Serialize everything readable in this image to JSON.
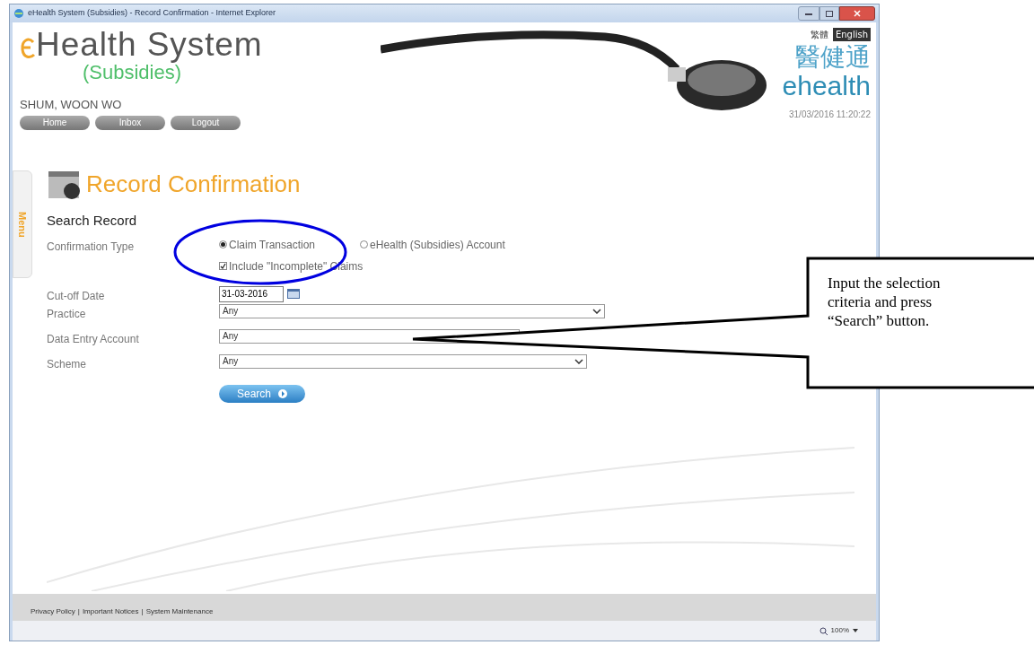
{
  "window": {
    "title": "eHealth System (Subsidies) - Record Confirmation - Internet Explorer"
  },
  "header": {
    "logo_title": "Health System",
    "logo_subtitle": "(Subsidies)",
    "user_name": "SHUM, WOON WO",
    "nav_buttons": [
      "Home",
      "Inbox",
      "Logout"
    ],
    "languages": [
      {
        "label": "繁體",
        "selected": false
      },
      {
        "label": "English",
        "selected": true
      }
    ],
    "brand_chinese": "醫健通",
    "brand_english": "ehealth",
    "datetime": "31/03/2016 11:20:22"
  },
  "side_menu": {
    "label": "Menu"
  },
  "page_title": "Record Confirmation",
  "form": {
    "section_title": "Search Record",
    "fields": [
      {
        "kind": "radio",
        "label": "Confirmation Type",
        "options": [
          {
            "label": "Claim Transaction",
            "selected": true
          },
          {
            "label": "eHealth (Subsidies) Account",
            "selected": false
          }
        ],
        "checkbox": {
          "label": "Include \"Incomplete\" Claims",
          "checked": true
        }
      },
      {
        "kind": "date",
        "label": "Cut-off Date",
        "value": "31-03-2016"
      },
      {
        "kind": "select",
        "label": "Practice",
        "value": "Any"
      },
      {
        "kind": "select",
        "label": "Data Entry Account",
        "value": "Any"
      },
      {
        "kind": "select",
        "label": "Scheme",
        "value": "Any"
      }
    ],
    "search_button": "Search"
  },
  "footer": {
    "links": [
      "Privacy Policy",
      "Important Notices",
      "System Maintenance"
    ],
    "separator": "|"
  },
  "status_bar": {
    "zoom": "100%"
  },
  "callout": {
    "text": "Input the selection criteria and press “Search” button."
  }
}
